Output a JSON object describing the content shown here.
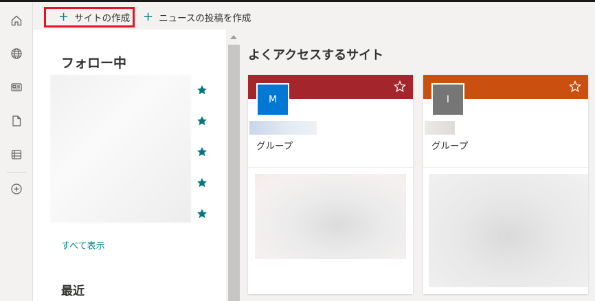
{
  "rail": {
    "items": [
      {
        "name": "home",
        "icon": "home-icon"
      },
      {
        "name": "sites",
        "icon": "globe-icon"
      },
      {
        "name": "news",
        "icon": "news-icon"
      },
      {
        "name": "files",
        "icon": "document-icon"
      },
      {
        "name": "lists",
        "icon": "list-icon"
      },
      {
        "name": "create",
        "icon": "add-circle-icon"
      }
    ]
  },
  "command_bar": {
    "create_site": "サイトの作成",
    "create_news": "ニュースの投稿を作成"
  },
  "following": {
    "title": "フォロー中",
    "see_all": "すべて表示",
    "star_color": "#03787c"
  },
  "recent": {
    "title": "最近"
  },
  "frequent_sites": {
    "title": "よくアクセスするサイト",
    "cards": [
      {
        "logo_letter": "M",
        "header_color": "#a4262c",
        "logo_color": "#0078d4",
        "type": "グループ"
      },
      {
        "logo_letter": "I",
        "header_color": "#ca5010",
        "logo_color": "#767676",
        "type": "グループ"
      }
    ]
  }
}
